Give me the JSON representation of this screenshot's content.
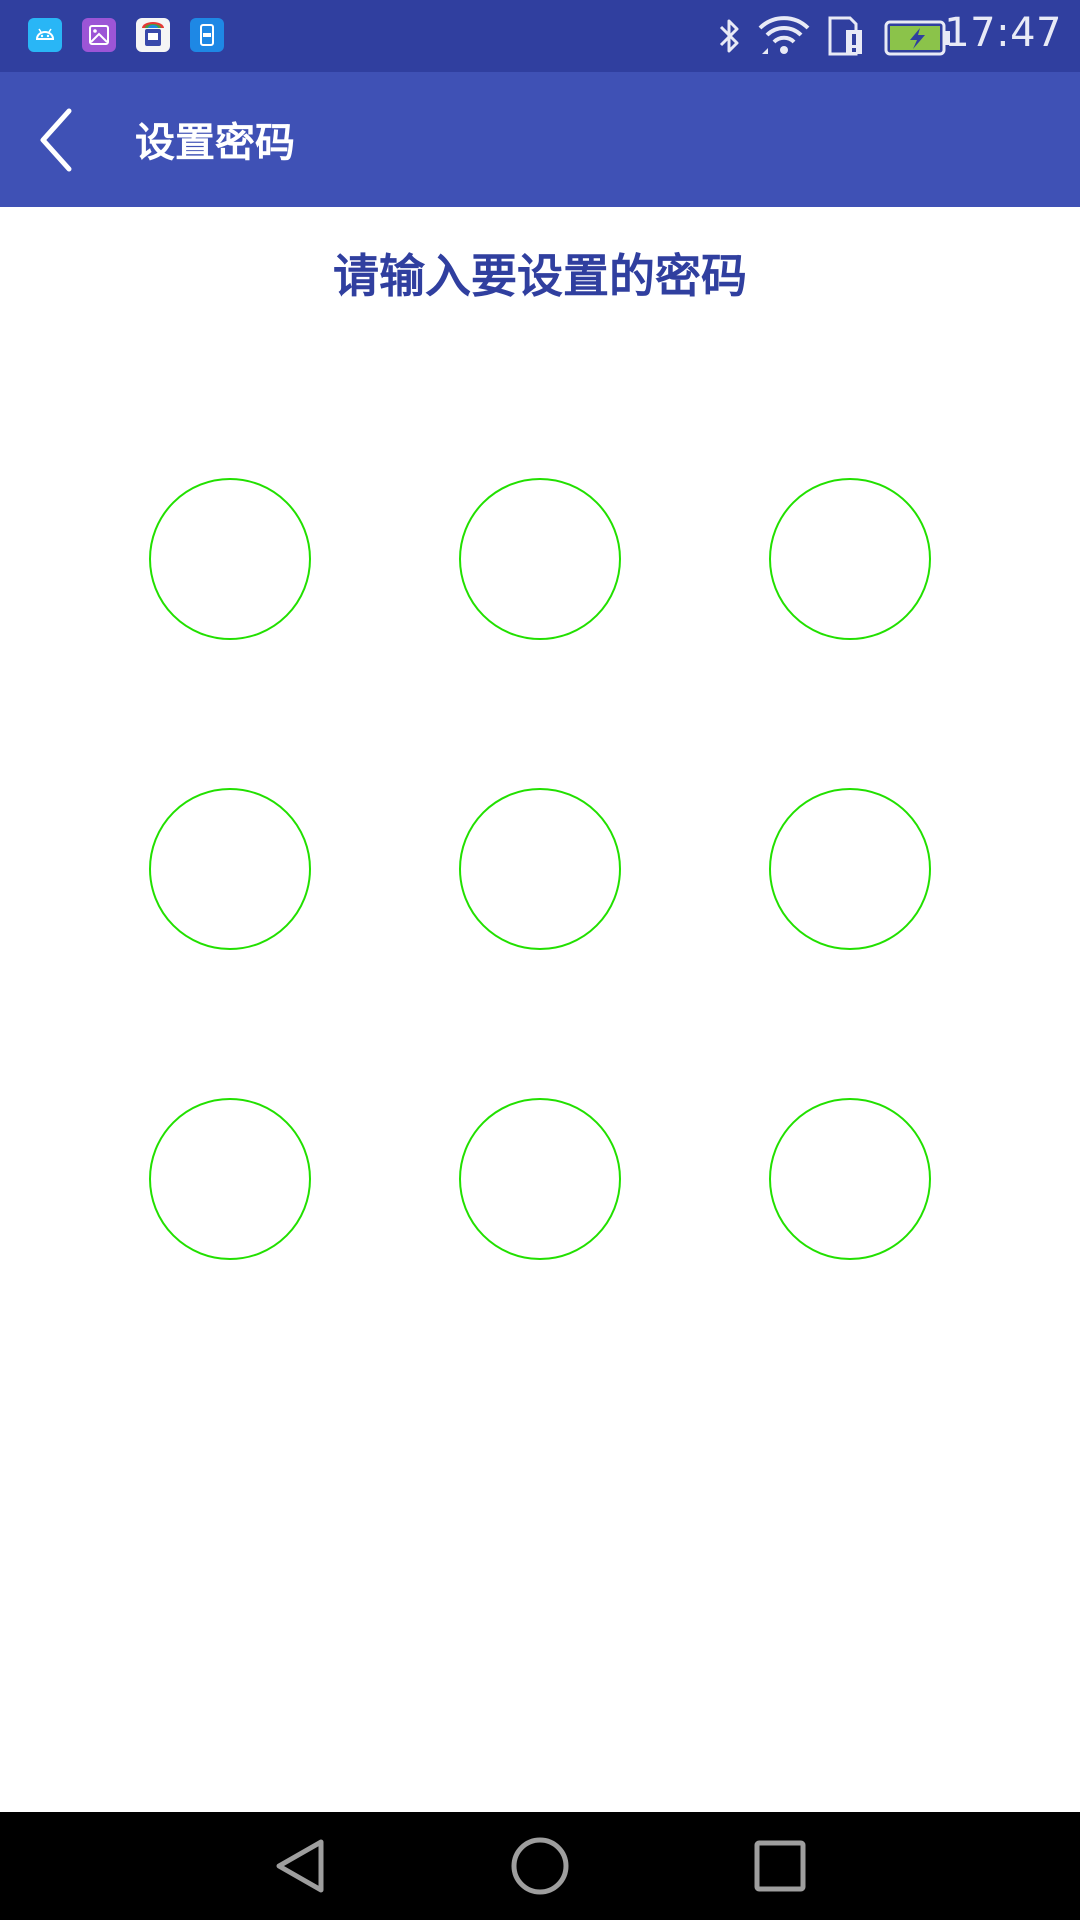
{
  "status_bar": {
    "time": "17:47",
    "notification_icons": [
      "android-debug-icon",
      "gallery-icon",
      "store-icon",
      "sim-toolkit-icon"
    ],
    "system_icons": [
      "bluetooth-icon",
      "wifi-icon",
      "sim-alert-icon",
      "battery-charging-icon"
    ],
    "colors": {
      "background": "#303f9f",
      "battery_fill": "#8bc34a"
    }
  },
  "app_bar": {
    "title": "设置密码",
    "back_icon": "chevron-left-icon",
    "colors": {
      "background": "#3f51b5",
      "text": "#ffffff"
    }
  },
  "prompt": {
    "text": "请输入要设置的密码",
    "color": "#303f9f"
  },
  "pattern": {
    "rows": 3,
    "cols": 3,
    "dot_color": "#22e000",
    "dots": [
      {
        "id": 1
      },
      {
        "id": 2
      },
      {
        "id": 3
      },
      {
        "id": 4
      },
      {
        "id": 5
      },
      {
        "id": 6
      },
      {
        "id": 7
      },
      {
        "id": 8
      },
      {
        "id": 9
      }
    ]
  },
  "nav_bar": {
    "buttons": [
      "back-triangle-icon",
      "home-circle-icon",
      "recents-square-icon"
    ],
    "color": "#000000"
  }
}
